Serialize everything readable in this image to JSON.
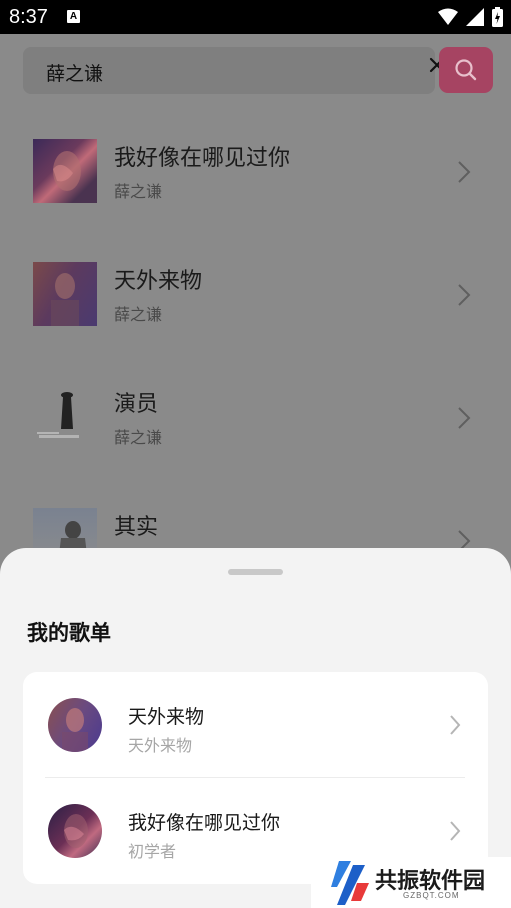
{
  "status_bar": {
    "time": "8:37",
    "badge_letter": "A"
  },
  "search": {
    "query": "薛之谦"
  },
  "songs": [
    {
      "title": "我好像在哪见过你",
      "artist": "薛之谦"
    },
    {
      "title": "天外来物",
      "artist": "薛之谦"
    },
    {
      "title": "演员",
      "artist": "薛之谦"
    },
    {
      "title": "其实",
      "artist": ""
    }
  ],
  "sheet": {
    "title": "我的歌单",
    "playlists": [
      {
        "name": "天外来物",
        "subtitle": "天外来物"
      },
      {
        "name": "我好像在哪见过你",
        "subtitle": "初学者"
      }
    ]
  },
  "watermark": {
    "text": "共振软件园",
    "domain": "GZBQT.COM"
  },
  "colors": {
    "search_button": "#a64462",
    "sheet_bg": "#f3f3f3",
    "card_bg": "#ffffff"
  }
}
